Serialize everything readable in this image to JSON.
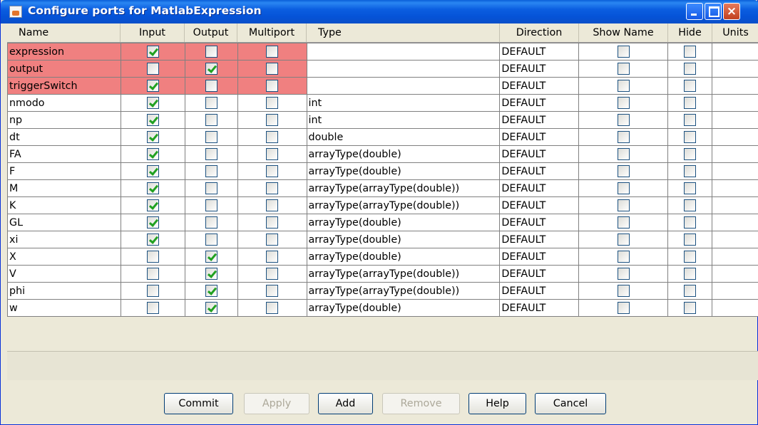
{
  "window": {
    "title": "Configure ports for MatlabExpression"
  },
  "columns": [
    "Name",
    "Input",
    "Output",
    "Multiport",
    "Type",
    "Direction",
    "Show Name",
    "Hide",
    "Units"
  ],
  "ports": [
    {
      "name": "expression",
      "input": true,
      "output": false,
      "multiport": false,
      "type": "",
      "direction": "DEFAULT",
      "show_name": false,
      "hide": false,
      "highlight": true
    },
    {
      "name": "output",
      "input": false,
      "output": true,
      "multiport": false,
      "type": "",
      "direction": "DEFAULT",
      "show_name": false,
      "hide": false,
      "highlight": true
    },
    {
      "name": "triggerSwitch",
      "input": true,
      "output": false,
      "multiport": false,
      "type": "",
      "direction": "DEFAULT",
      "show_name": false,
      "hide": false,
      "highlight": true
    },
    {
      "name": "nmodo",
      "input": true,
      "output": false,
      "multiport": false,
      "type": "int",
      "direction": "DEFAULT",
      "show_name": false,
      "hide": false,
      "highlight": false
    },
    {
      "name": "np",
      "input": true,
      "output": false,
      "multiport": false,
      "type": "int",
      "direction": "DEFAULT",
      "show_name": false,
      "hide": false,
      "highlight": false
    },
    {
      "name": "dt",
      "input": true,
      "output": false,
      "multiport": false,
      "type": "double",
      "direction": "DEFAULT",
      "show_name": false,
      "hide": false,
      "highlight": false
    },
    {
      "name": "FA",
      "input": true,
      "output": false,
      "multiport": false,
      "type": "arrayType(double)",
      "direction": "DEFAULT",
      "show_name": false,
      "hide": false,
      "highlight": false
    },
    {
      "name": "F",
      "input": true,
      "output": false,
      "multiport": false,
      "type": "arrayType(double)",
      "direction": "DEFAULT",
      "show_name": false,
      "hide": false,
      "highlight": false
    },
    {
      "name": "M",
      "input": true,
      "output": false,
      "multiport": false,
      "type": "arrayType(arrayType(double))",
      "direction": "DEFAULT",
      "show_name": false,
      "hide": false,
      "highlight": false
    },
    {
      "name": "K",
      "input": true,
      "output": false,
      "multiport": false,
      "type": "arrayType(arrayType(double))",
      "direction": "DEFAULT",
      "show_name": false,
      "hide": false,
      "highlight": false
    },
    {
      "name": "GL",
      "input": true,
      "output": false,
      "multiport": false,
      "type": "arrayType(double)",
      "direction": "DEFAULT",
      "show_name": false,
      "hide": false,
      "highlight": false
    },
    {
      "name": "xi",
      "input": true,
      "output": false,
      "multiport": false,
      "type": "arrayType(double)",
      "direction": "DEFAULT",
      "show_name": false,
      "hide": false,
      "highlight": false
    },
    {
      "name": "X",
      "input": false,
      "output": true,
      "multiport": false,
      "type": "arrayType(double)",
      "direction": "DEFAULT",
      "show_name": false,
      "hide": false,
      "highlight": false
    },
    {
      "name": "V",
      "input": false,
      "output": true,
      "multiport": false,
      "type": "arrayType(arrayType(double))",
      "direction": "DEFAULT",
      "show_name": false,
      "hide": false,
      "highlight": false
    },
    {
      "name": "phi",
      "input": false,
      "output": true,
      "multiport": false,
      "type": "arrayType(arrayType(double))",
      "direction": "DEFAULT",
      "show_name": false,
      "hide": false,
      "highlight": false
    },
    {
      "name": "w",
      "input": false,
      "output": true,
      "multiport": false,
      "type": "arrayType(double)",
      "direction": "DEFAULT",
      "show_name": false,
      "hide": false,
      "highlight": false
    }
  ],
  "buttons": {
    "commit": "Commit",
    "apply": "Apply",
    "add": "Add",
    "remove": "Remove",
    "help": "Help",
    "cancel": "Cancel"
  },
  "colors": {
    "highlight_row": "#f08080",
    "titlebar": "#0553d8",
    "check": "#21a121"
  },
  "icons": {
    "app": "java-cup-icon",
    "minimize": "minimize-icon",
    "maximize": "maximize-icon",
    "close": "close-icon"
  }
}
